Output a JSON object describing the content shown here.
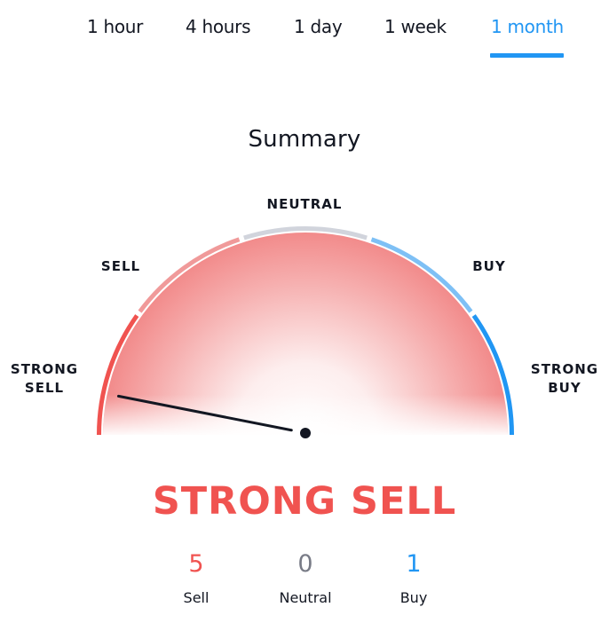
{
  "tabs": [
    {
      "label": "1 hour",
      "active": false
    },
    {
      "label": "4 hours",
      "active": false
    },
    {
      "label": "1 day",
      "active": false
    },
    {
      "label": "1 week",
      "active": false
    },
    {
      "label": "1 month",
      "active": true
    }
  ],
  "summary": {
    "title": "Summary",
    "gauge": {
      "labels": {
        "strong_sell": "STRONG\nSELL",
        "sell": "SELL",
        "neutral": "NEUTRAL",
        "buy": "BUY",
        "strong_buy": "STRONG\nBUY"
      },
      "segment_colors": {
        "strong_sell": "#f05350",
        "sell": "#f09a9a",
        "neutral": "#d1d4dc",
        "buy": "#7ec0f5",
        "strong_buy": "#2196f3"
      },
      "needle_value": -0.87
    },
    "verdict": "STRONG SELL",
    "verdict_color": "#f05350",
    "counts": [
      {
        "value": "5",
        "label": "Sell",
        "color": "#f05350"
      },
      {
        "value": "0",
        "label": "Neutral",
        "color": "#787b86"
      },
      {
        "value": "1",
        "label": "Buy",
        "color": "#2196f3"
      }
    ]
  }
}
